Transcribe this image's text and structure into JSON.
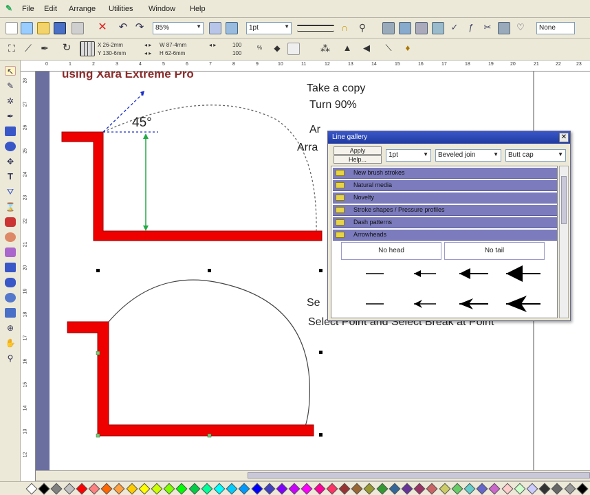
{
  "menu": [
    "File",
    "Edit",
    "Arrange",
    "Utilities",
    "Window",
    "Help"
  ],
  "toolbar1": {
    "zoom": "85%",
    "line_width": "1pt",
    "style": "None"
  },
  "toolbar2": {
    "x": "X 26-2mm",
    "y": "Y 130-6mm",
    "w": "W 87-4mm",
    "h": "H 62-6mm",
    "scale_w": "100",
    "scale_h": "100",
    "pct": "%"
  },
  "ruler_h": [
    "0",
    "1",
    "2",
    "3",
    "4",
    "5",
    "6",
    "7",
    "8",
    "9",
    "10",
    "11",
    "12",
    "13",
    "14",
    "15",
    "16",
    "17",
    "18",
    "19",
    "20",
    "21",
    "22",
    "23"
  ],
  "ruler_v": [
    "28",
    "27",
    "26",
    "25",
    "24",
    "23",
    "22",
    "21",
    "20",
    "19",
    "18",
    "17",
    "16",
    "15",
    "14",
    "13",
    "12"
  ],
  "canvas": {
    "heading": "using Xara Extreme Pro",
    "angle_label": "45°",
    "instructions": [
      "Take a copy",
      "Turn 90%",
      "Ar",
      "Arra",
      "Se",
      "Select Point and Select Break at Point"
    ]
  },
  "gallery": {
    "title": "Line gallery",
    "apply": "Apply",
    "help": "Help...",
    "width": "1pt",
    "join": "Beveled join",
    "cap": "Butt cap",
    "folders": [
      "New brush strokes",
      "Natural media",
      "Novelty",
      "Stroke shapes / Pressure profiles",
      "Dash patterns",
      "Arrowheads"
    ],
    "no_head": "No head",
    "no_tail": "No tail"
  },
  "colors": {
    "accent_red": "#ee0000",
    "title_blue": "#1f3aa0",
    "folder_purple": "#7b7bbd"
  },
  "palette": [
    "#ffffff",
    "#000000",
    "#808080",
    "#c0c0c0",
    "#ff0000",
    "#ff8080",
    "#ff6600",
    "#ffa040",
    "#ffcc00",
    "#ffff00",
    "#ccff00",
    "#80ff00",
    "#00ff00",
    "#00cc44",
    "#00ff99",
    "#00ffff",
    "#00ccff",
    "#0099ff",
    "#0000ff",
    "#4040c0",
    "#8000ff",
    "#cc00ff",
    "#ff00ff",
    "#ff0099",
    "#ff3366",
    "#993333",
    "#996633",
    "#999933",
    "#339933",
    "#336699",
    "#663399",
    "#993366",
    "#cc6666",
    "#cccc66",
    "#66cc66",
    "#66cccc",
    "#6666cc",
    "#cc66cc",
    "#ffcccc",
    "#ccffcc",
    "#ccccff",
    "#333333",
    "#666666",
    "#999999",
    "#000000"
  ]
}
